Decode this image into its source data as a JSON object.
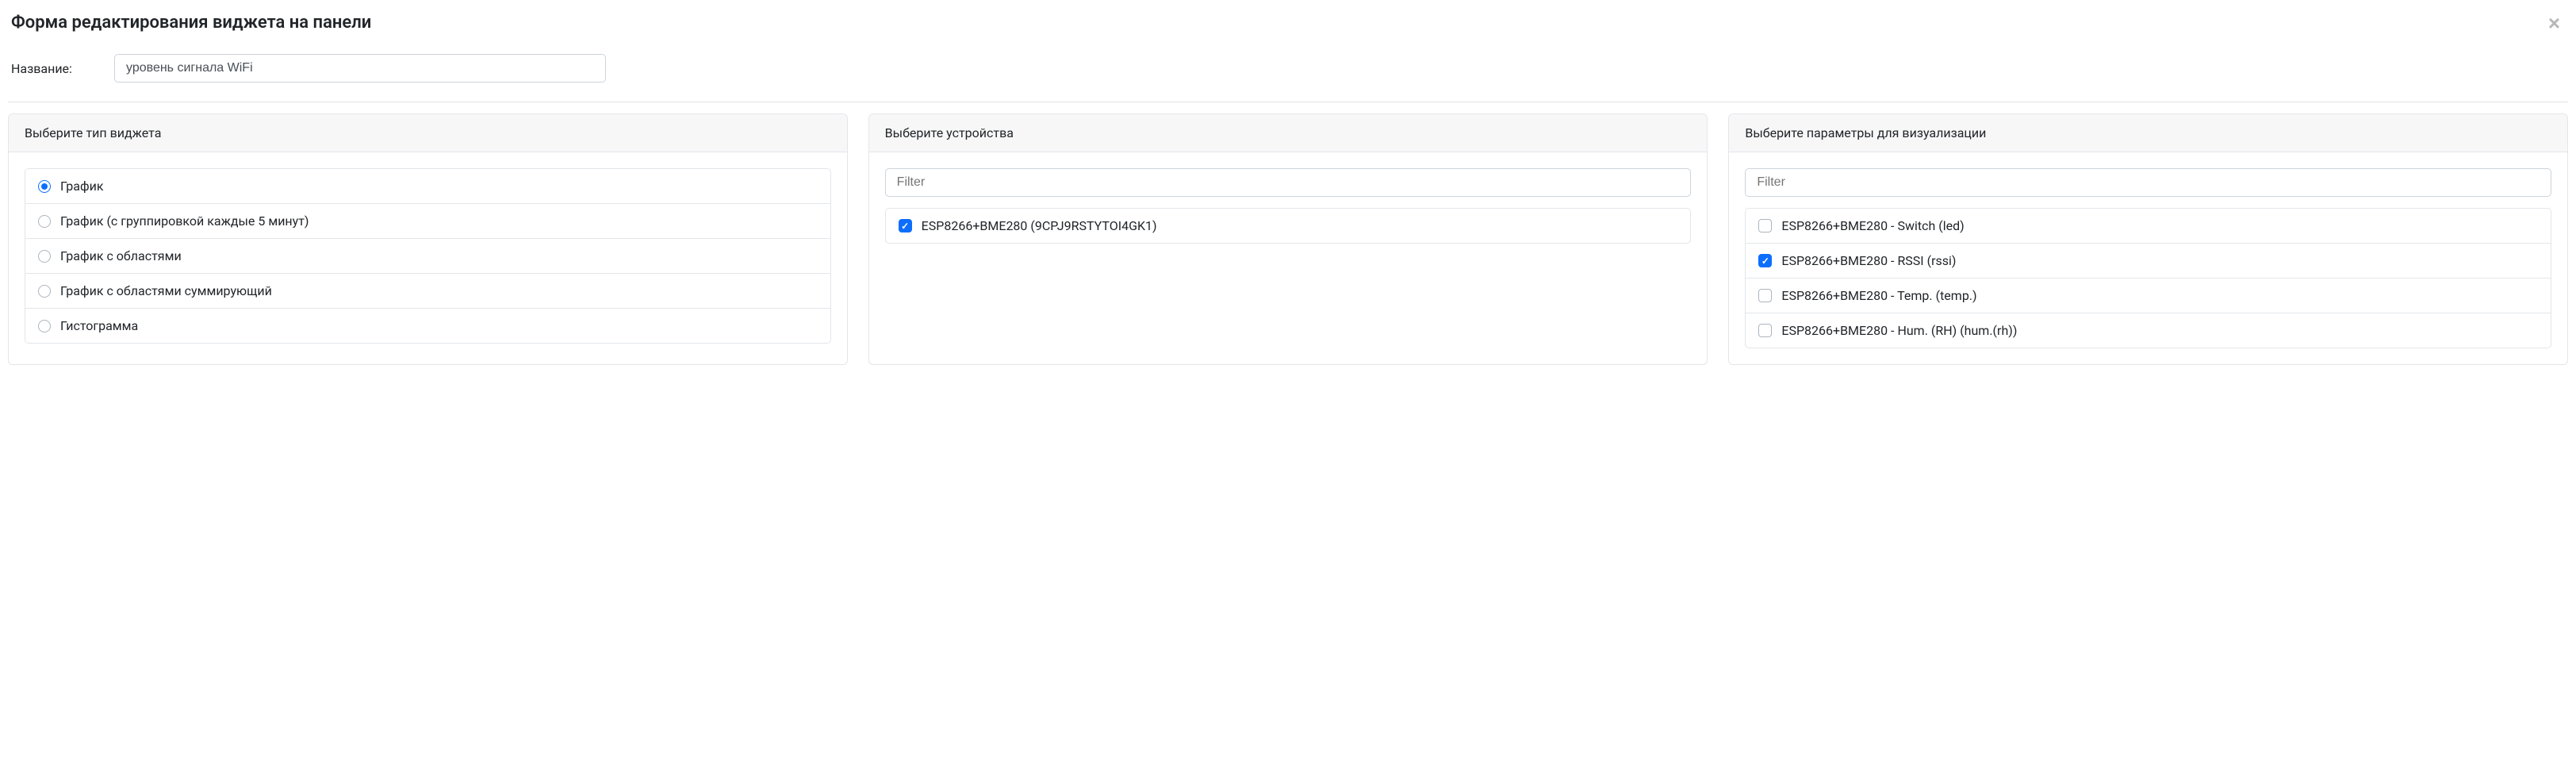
{
  "modal": {
    "title": "Форма редактирования виджета на панели"
  },
  "name_field": {
    "label": "Название:",
    "value": "уровень сигнала WiFi"
  },
  "widget_type_panel": {
    "title": "Выберите тип виджета",
    "options": [
      {
        "label": "График",
        "checked": true
      },
      {
        "label": "График (с группировкой каждые 5 минут)",
        "checked": false
      },
      {
        "label": "График с областями",
        "checked": false
      },
      {
        "label": "График с областями суммирующий",
        "checked": false
      },
      {
        "label": "Гистограмма",
        "checked": false
      }
    ]
  },
  "devices_panel": {
    "title": "Выберите устройства",
    "filter_placeholder": "Filter",
    "items": [
      {
        "label": "ESP8266+BME280 (9CPJ9RSTYTOI4GK1)",
        "checked": true
      }
    ]
  },
  "params_panel": {
    "title": "Выберите параметры для визуализации",
    "filter_placeholder": "Filter",
    "items": [
      {
        "label": "ESP8266+BME280 - Switch (led)",
        "checked": false
      },
      {
        "label": "ESP8266+BME280 - RSSI (rssi)",
        "checked": true
      },
      {
        "label": "ESP8266+BME280 - Temp. (temp.)",
        "checked": false
      },
      {
        "label": "ESP8266+BME280 - Hum. (RH) (hum.(rh))",
        "checked": false
      }
    ]
  }
}
